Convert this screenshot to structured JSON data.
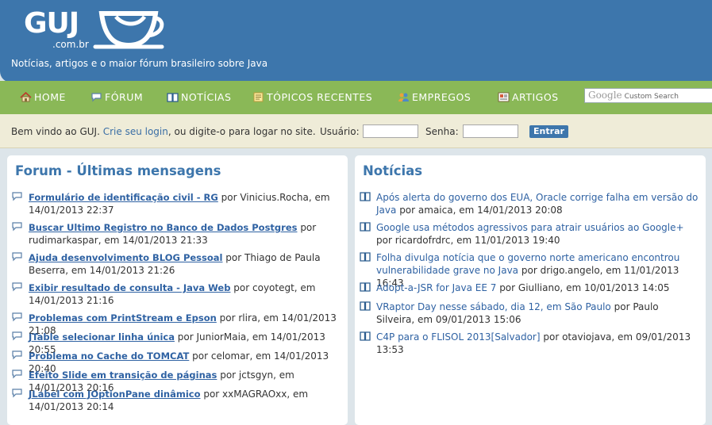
{
  "header": {
    "logo": "GUJ",
    "logo_sub": ".com.br",
    "tagline": "Notícias, artigos e o maior fórum brasileiro sobre Java"
  },
  "nav": {
    "items": [
      {
        "label": "HOME",
        "icon": "home-icon"
      },
      {
        "label": "FÓRUM",
        "icon": "speech-bubble-icon"
      },
      {
        "label": "NOTÍCIAS",
        "icon": "book-icon"
      },
      {
        "label": "TÓPICOS RECENTES",
        "icon": "notes-icon"
      },
      {
        "label": "EMPREGOS",
        "icon": "people-icon"
      },
      {
        "label": "ARTIGOS",
        "icon": "article-icon"
      }
    ],
    "search": {
      "brand": "Google",
      "placeholder": "Custom Search"
    }
  },
  "login": {
    "welcome_prefix": "Bem vindo ao GUJ.",
    "signup_link": "Crie seu login",
    "welcome_suffix": ", ou digite-o para logar no site.",
    "user_label": "Usuário:",
    "password_label": "Senha:",
    "submit_label": "Entrar"
  },
  "forum": {
    "title": "Forum - Últimas mensagens",
    "posts": [
      {
        "title": "Formulário de identificação civil - RG",
        "meta": "por Vinicius.Rocha, em 14/01/2013 22:37"
      },
      {
        "title": "Buscar Ultimo Registro no Banco de Dados Postgres",
        "meta": "por rudimarkaspar, em 14/01/2013 21:33"
      },
      {
        "title": "Ajuda desenvolvimento BLOG Pessoal",
        "meta": "por Thiago de Paula Beserra, em 14/01/2013 21:26"
      },
      {
        "title": "Exibir resultado de consulta - Java Web",
        "meta": "por coyotegt, em 14/01/2013 21:16"
      },
      {
        "title": "Problemas com PrintStream e Epson",
        "meta": "por rlira, em 14/01/2013 21:08"
      },
      {
        "title": "JTable selecionar linha única",
        "meta": "por JuniorMaia, em 14/01/2013 20:55"
      },
      {
        "title": "Problema no Cache do TOMCAT",
        "meta": "por celomar, em 14/01/2013 20:40"
      },
      {
        "title": "Efeito Slide em transição de páginas",
        "meta": "por jctsgyn, em 14/01/2013 20:16"
      },
      {
        "title": "JLabel com JOptionPane dinâmico",
        "meta": "por xxMAGRAOxx, em 14/01/2013 20:14"
      }
    ]
  },
  "news": {
    "title": "Notícias",
    "items": [
      {
        "title": "Após alerta do governo dos EUA, Oracle corrige falha em versão do Java",
        "meta": "por amaica, em 14/01/2013 20:08"
      },
      {
        "title": "Google usa métodos agressivos para atrair usuários ao Google+",
        "meta": "por ricardofrdrc, em 11/01/2013 19:40"
      },
      {
        "title": "Folha divulga notícia que o governo norte americano encontrou vulnerabilidade grave no Java",
        "meta": "por drigo.angelo, em 11/01/2013 16:43"
      },
      {
        "title": "Adopt-a-JSR for Java EE 7",
        "meta": "por Giulliano, em 10/01/2013 14:05"
      },
      {
        "title": "VRaptor Day nesse sábado, dia 12, em São Paulo",
        "meta": "por Paulo Silveira, em 09/01/2013 15:06"
      },
      {
        "title": "C4P para o FLISOL 2013[Salvador]",
        "meta": "por otaviojava, em 09/01/2013 13:53"
      }
    ]
  },
  "colors": {
    "header": "#3d76ac",
    "nav": "#8ab857",
    "login_bar": "#efecd8",
    "link": "#2f62a3",
    "heading": "#3d76ac"
  }
}
